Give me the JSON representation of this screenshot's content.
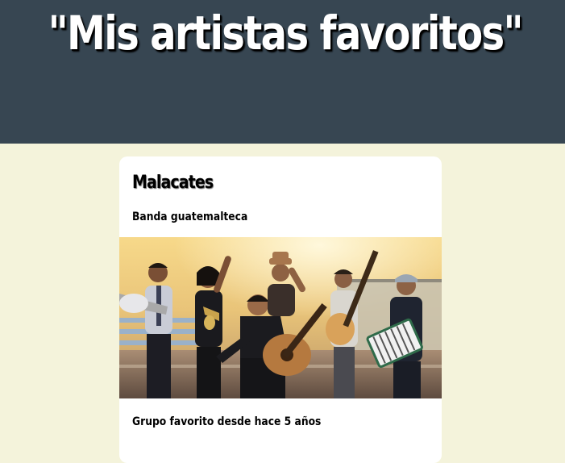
{
  "header": {
    "title": "\"Mis artistas favoritos\"",
    "background_color": "#374652"
  },
  "page": {
    "background_color": "#f4f3db"
  },
  "card": {
    "title": "Malacates",
    "subtitle": "Banda guatemalteca",
    "image_subject": "band-photo",
    "note": "Grupo favorito desde hace 5 años"
  }
}
